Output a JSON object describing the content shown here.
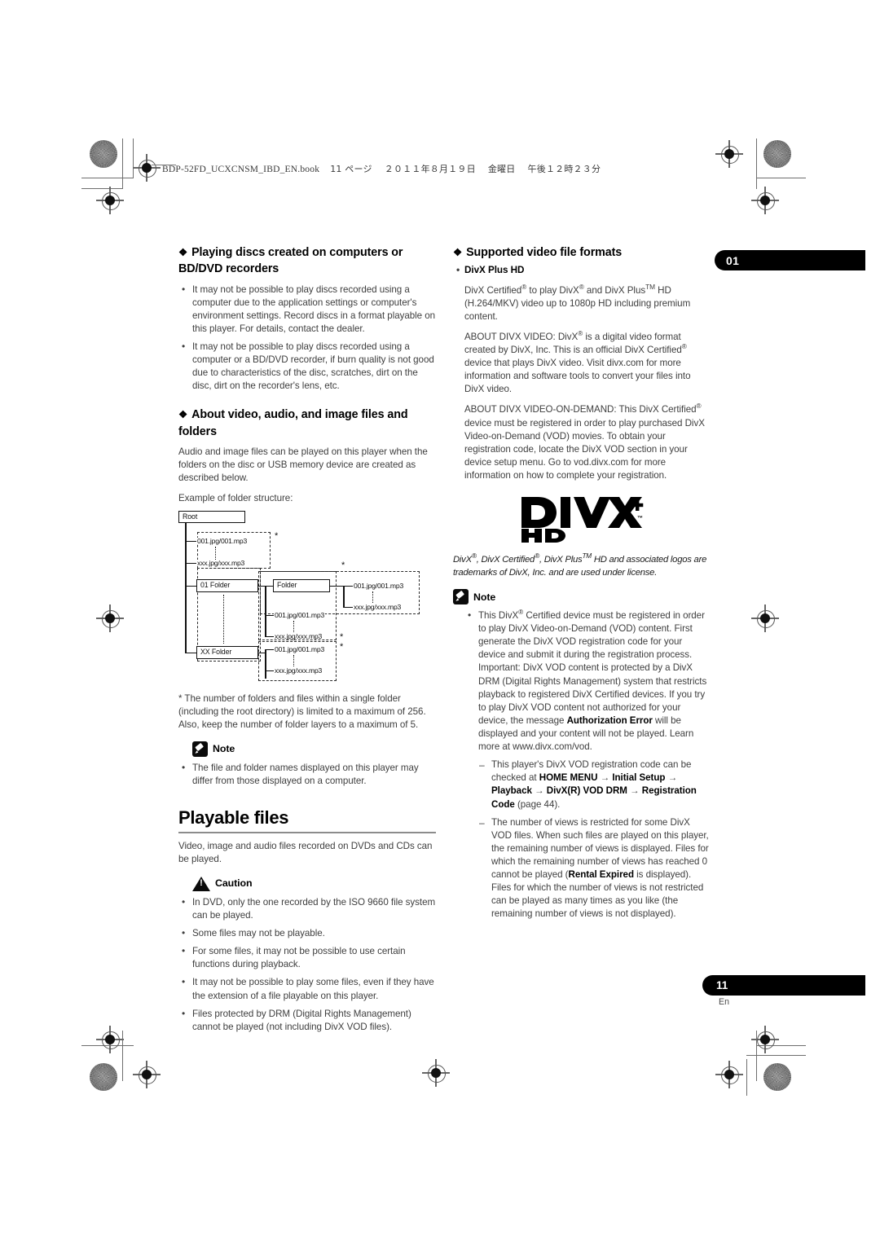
{
  "print_slug": {
    "filename": "BDP-52FD_UCXCNSM_IBD_EN.book",
    "page_label": "11 ページ",
    "date": "２０１１年８月１９日",
    "weekday": "金曜日",
    "time": "午後１２時２３分"
  },
  "chapter_tab": {
    "number": "01"
  },
  "page_tab": {
    "number": "11",
    "language": "En"
  },
  "left_column": {
    "section1": {
      "heading": "Playing discs created on computers or BD/DVD recorders",
      "bullets": [
        "It may not be possible to play discs recorded using a computer due to the application settings or computer's environment settings. Record discs in a format playable on this player. For details, contact the dealer.",
        "It may not be possible to play discs recorded using a computer or a BD/DVD recorder, if burn quality is not good due to characteristics of the disc, scratches, dirt on the disc, dirt on the recorder's lens, etc."
      ]
    },
    "section2": {
      "heading": "About video, audio, and image files and folders",
      "paragraph": "Audio and image files can be played on this player when the folders on the disc or USB memory device are created as described below.",
      "example_label": "Example of folder structure:",
      "diagram": {
        "root_label": "Root",
        "folder_01_label": "01 Folder",
        "folder_xx_label": "XX Folder",
        "subfolder_label": "Folder",
        "file_first": "001.jpg/001.mp3",
        "file_last": "xxx.jpg/xxx.mp3",
        "star": "*"
      },
      "footnote": "* The number of folders and files within a single folder (including the root directory) is limited to a maximum of 256. Also, keep the number of folder layers to a maximum of 5.",
      "note_label": "Note",
      "note_bullets": [
        "The file and folder names displayed on this player may differ from those displayed on a computer."
      ]
    },
    "section3": {
      "heading": "Playable files",
      "paragraph": "Video, image and audio files recorded on DVDs and CDs can be played.",
      "caution_label": "Caution",
      "caution_bullets": [
        "In DVD, only the one recorded by the ISO 9660 file system can be played.",
        "Some files may not be playable.",
        "For some files, it may not be possible to use certain functions during playback.",
        "It may not be possible to play some files, even if they have the extension of a file playable on this player.",
        "Files protected by DRM (Digital Rights Management) cannot be played (not including DivX VOD files)."
      ]
    }
  },
  "right_column": {
    "heading": "Supported video file formats",
    "subhead": "DivX Plus HD",
    "paragraph1_parts": {
      "a": "DivX Certified",
      "b": " to play DivX",
      "c": " and DivX Plus",
      "d": " HD (H.264/MKV) video up to 1080p HD including premium content."
    },
    "paragraph2_parts": {
      "a": "ABOUT DIVX VIDEO: DivX",
      "b": " is a digital video format created by DivX, Inc. This is an official DivX Certified",
      "c": " device that plays DivX video. Visit divx.com for more information and software tools to convert your files into DivX video."
    },
    "paragraph3_parts": {
      "a": "ABOUT DIVX VIDEO-ON-DEMAND: This DivX Certified",
      "b": " device must be registered in order to play purchased DivX Video-on-Demand (VOD) movies. To obtain your registration code, locate the DivX VOD section in your device setup menu. Go to vod.divx.com for more information on how to complete your registration."
    },
    "logo": {
      "wordmark": "DIVX",
      "plus": "+",
      "tm": "™",
      "sub": "HD"
    },
    "trademark_parts": {
      "a": "DivX",
      "b": ", DivX Certified",
      "c": ", DivX Plus",
      "d": " HD and associated logos are trademarks of DivX, Inc. and are used under license."
    },
    "note_label": "Note",
    "note_bullet_parts": {
      "a": "This DivX",
      "b": " Certified device must be registered in order to play DivX Video-on-Demand (VOD) content. First generate the DivX VOD registration code for your device and submit it during the registration process. Important: DivX VOD content is protected by a DivX DRM (Digital Rights Management) system that restricts playback to registered DivX Certified devices. If you try to play DivX VOD content not authorized for your device, the message ",
      "bold": "Authorization Error",
      "c": " will be displayed and your content will not be played. Learn more at www.divx.com/vod."
    },
    "sub_bullets": {
      "item1": {
        "a": "This player's DivX VOD registration code can be checked at ",
        "path1": "HOME MENU",
        "arrow": "→",
        "path2": "Initial Setup",
        "path3": "Playback",
        "path4": "DivX(R) VOD DRM",
        "path5": "Registration Code",
        "b": " (page 44)."
      },
      "item2": {
        "a": "The number of views is restricted for some DivX VOD files. When such files are played on this player, the remaining number of views is displayed. Files for which the remaining number of views has reached 0 cannot be played (",
        "bold": "Rental Expired",
        "b": " is displayed). Files for which the number of views is not restricted can be played as many times as you like (the remaining number of views is not displayed)."
      }
    }
  }
}
